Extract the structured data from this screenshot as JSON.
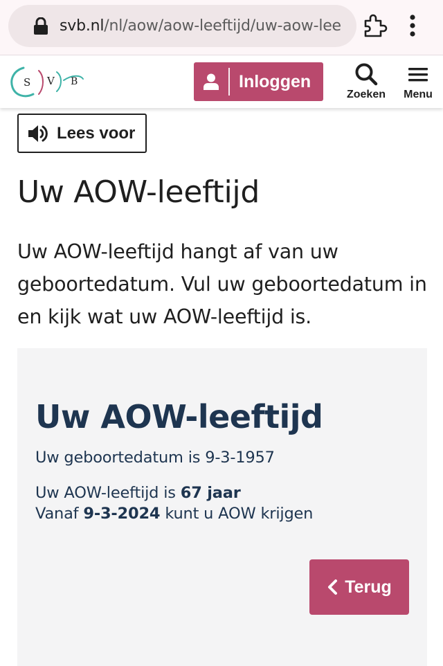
{
  "browser": {
    "url_host": "svb.nl",
    "url_path": "/nl/aow/aow-leeftijd/uw-aow-lee",
    "icons": {
      "lock": "lock-icon",
      "extension": "puzzle-icon",
      "menu": "kebab-icon"
    }
  },
  "header": {
    "logo_letters": [
      "S",
      "V",
      "B"
    ],
    "login_label": "Inloggen",
    "search_label": "Zoeken",
    "menu_label": "Menu",
    "accent_color": "#b9496d"
  },
  "read_aloud": {
    "label": "Lees voor"
  },
  "main": {
    "title": "Uw AOW-leeftijd",
    "intro": "Uw AOW-leeftijd hangt af van uw geboortedatum. Vul uw geboortedatum in en kijk wat uw AOW-leeftijd is."
  },
  "result": {
    "title": "Uw AOW-leeftijd",
    "birthdate_prefix": "Uw geboortedatum is",
    "birthdate": "9-3-1957",
    "age_prefix": "Uw AOW-leeftijd is",
    "age": "67 jaar",
    "from_prefix": "Vanaf",
    "from_date": "9-3-2024",
    "from_suffix": "kunt u AOW krijgen",
    "back_label": "Terug"
  }
}
